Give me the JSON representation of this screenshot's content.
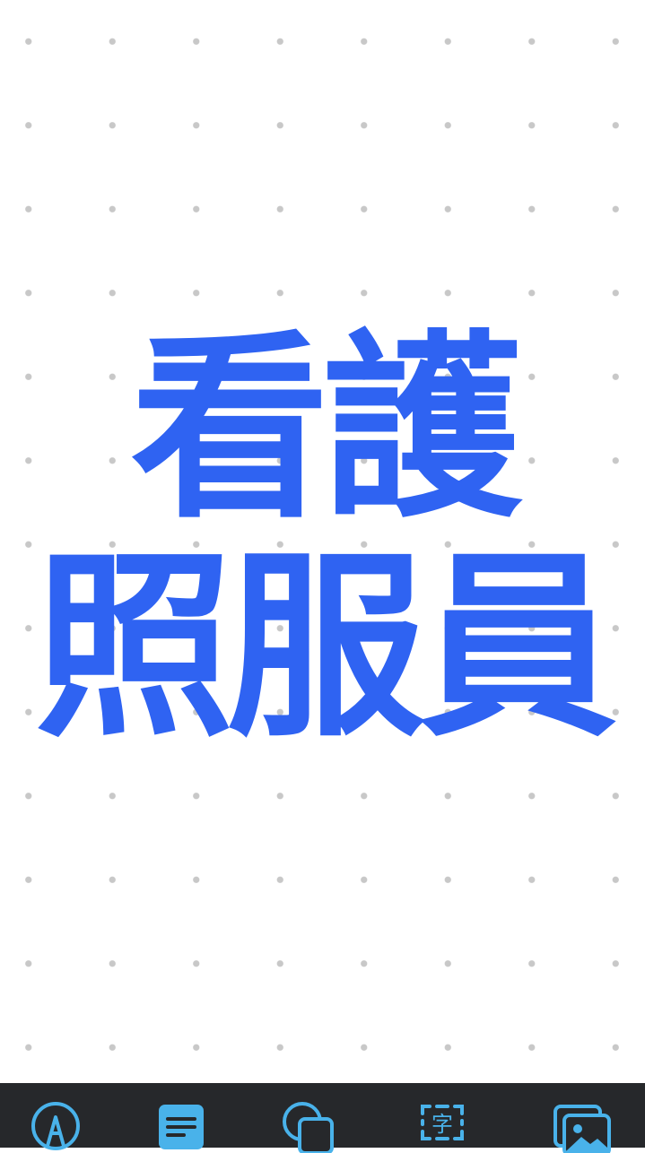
{
  "canvas": {
    "headline": {
      "line1": "看護",
      "line2": "照服員"
    },
    "text_color": "#2f63f2",
    "dot_color": "#c8c8c8"
  },
  "toolbar": {
    "background": "#26282b",
    "icon_color": "#49b2ea",
    "items": [
      {
        "icon": "pen-icon"
      },
      {
        "icon": "sticky-note-icon"
      },
      {
        "icon": "shapes-icon"
      },
      {
        "icon": "text-icon",
        "glyph": "字"
      },
      {
        "icon": "image-icon"
      }
    ]
  }
}
